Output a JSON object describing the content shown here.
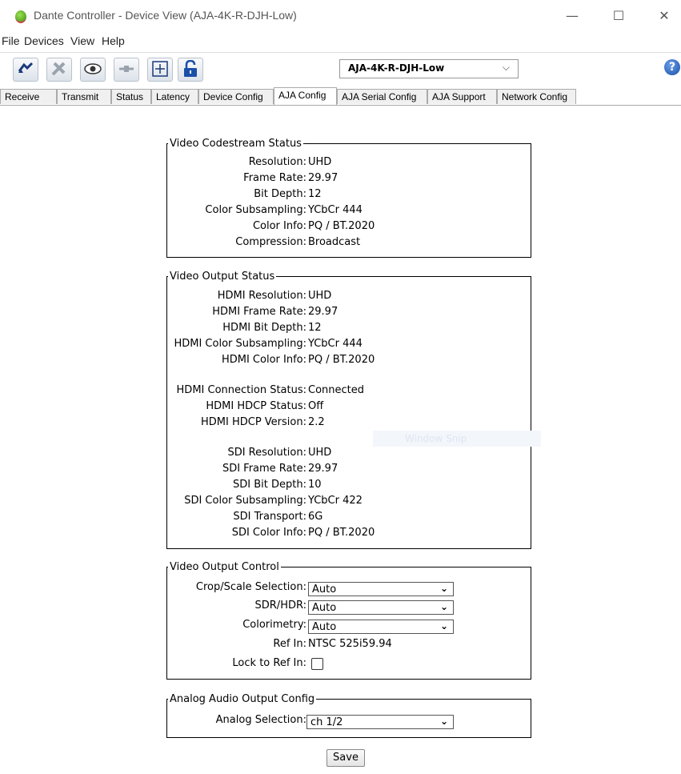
{
  "window": {
    "title": "Dante Controller - Device View (AJA-4K-R-DJH-Low)",
    "minimize": "—",
    "maximize": "☐",
    "close": "✕"
  },
  "menu": [
    "File",
    "Devices",
    "View",
    "Help"
  ],
  "toolbar": {
    "device": "AJA-4K-R-DJH-Low",
    "help": "?"
  },
  "tabs": [
    "Receive",
    "Transmit",
    "Status",
    "Latency",
    "Device Config",
    "AJA Config",
    "AJA Serial Config",
    "AJA Support",
    "Network Config"
  ],
  "active_tab": "AJA Config",
  "codestream": {
    "legend": "Video Codestream Status",
    "rows": [
      {
        "label": "Resolution:",
        "value": "UHD"
      },
      {
        "label": "Frame Rate:",
        "value": "29.97"
      },
      {
        "label": "Bit Depth:",
        "value": "12"
      },
      {
        "label": "Color Subsampling:",
        "value": "YCbCr 444"
      },
      {
        "label": "Color Info:",
        "value": "PQ / BT.2020"
      },
      {
        "label": "Compression:",
        "value": "Broadcast"
      }
    ]
  },
  "output_status": {
    "legend": "Video Output Status",
    "rows": [
      {
        "label": "HDMI Resolution:",
        "value": "UHD"
      },
      {
        "label": "HDMI Frame Rate:",
        "value": "29.97"
      },
      {
        "label": "HDMI Bit Depth:",
        "value": "12"
      },
      {
        "label": "HDMI Color Subsampling:",
        "value": "YCbCr 444"
      },
      {
        "label": "HDMI Color Info:",
        "value": "PQ / BT.2020"
      },
      {
        "label": "HDMI Connection Status:",
        "value": "Connected"
      },
      {
        "label": "HDMI HDCP Status:",
        "value": "Off"
      },
      {
        "label": "HDMI HDCP Version:",
        "value": "2.2"
      },
      {
        "label": "SDI Resolution:",
        "value": "UHD"
      },
      {
        "label": "SDI Frame Rate:",
        "value": "29.97"
      },
      {
        "label": "SDI Bit Depth:",
        "value": "10"
      },
      {
        "label": "SDI Color Subsampling:",
        "value": "YCbCr 422"
      },
      {
        "label": "SDI Transport:",
        "value": "6G"
      },
      {
        "label": "SDI Color Info:",
        "value": "PQ / BT.2020"
      }
    ]
  },
  "output_control": {
    "legend": "Video Output Control",
    "crop_label": "Crop/Scale Selection:",
    "crop_value": "Auto",
    "sdr_label": "SDR/HDR:",
    "sdr_value": "Auto",
    "colorimetry_label": "Colorimetry:",
    "colorimetry_value": "Auto",
    "refin_label": "Ref In:",
    "refin_value": "NTSC 525i59.94",
    "lock_label": "Lock to Ref In:",
    "lock_checked": false
  },
  "analog": {
    "legend": "Analog Audio Output Config",
    "selection_label": "Analog Selection:",
    "selection_value": "ch 1/2"
  },
  "save_label": "Save",
  "ghost_label": "Window Snip"
}
